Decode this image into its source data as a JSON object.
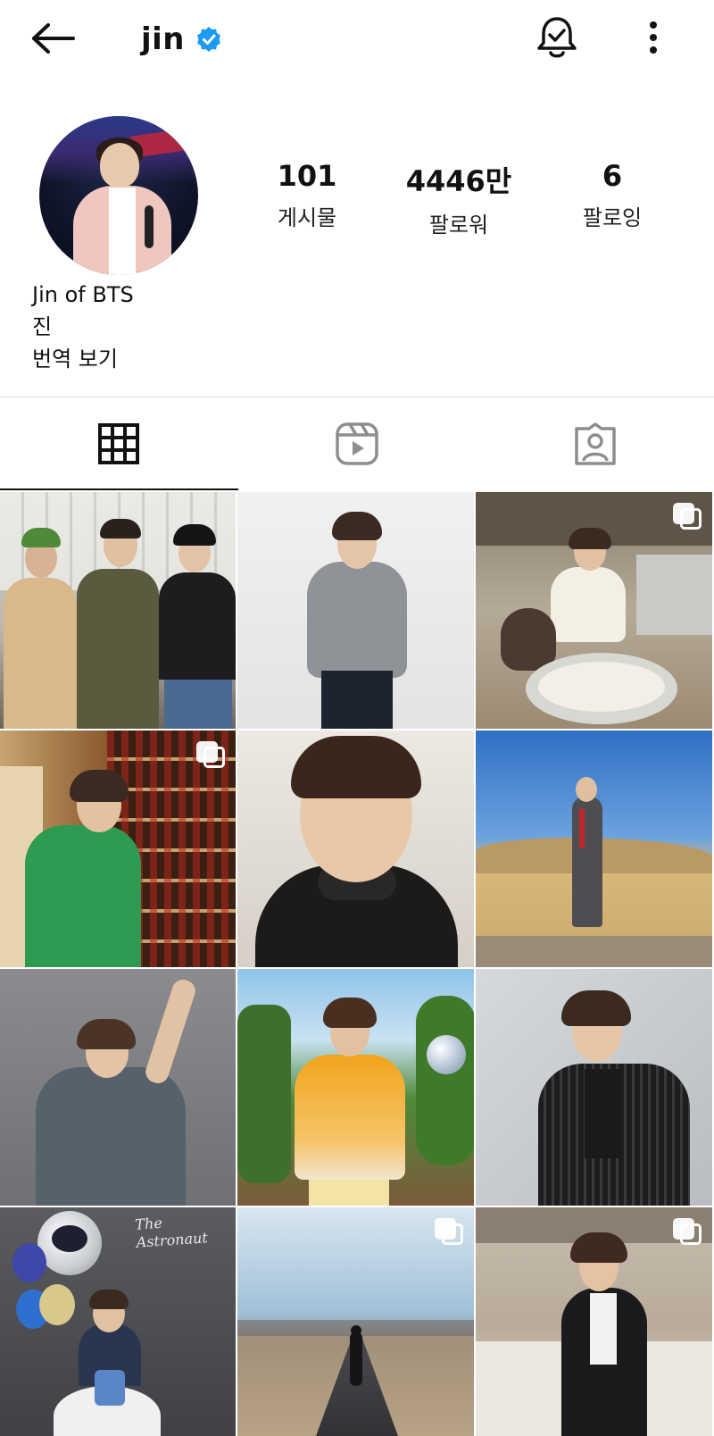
{
  "header": {
    "username": "jin",
    "verified": true,
    "accent_color": "#1d9bf0",
    "back_icon": "arrow-left-icon",
    "notification_icon": "bell-check-icon",
    "more_icon": "more-vertical-icon"
  },
  "profile": {
    "stats": {
      "posts_value": "101",
      "posts_label": "게시물",
      "followers_value": "4446만",
      "followers_label": "팔로워",
      "following_value": "6",
      "following_label": "팔로잉"
    },
    "bio": {
      "name_line": "Jin of BTS",
      "korean_line": "진",
      "translate_label": "번역 보기"
    }
  },
  "tabs": [
    {
      "icon": "grid-icon",
      "active": true
    },
    {
      "icon": "reels-icon",
      "active": false
    },
    {
      "icon": "tagged-icon",
      "active": false
    }
  ],
  "grid": {
    "posts": [
      {
        "index": 1,
        "multi": false
      },
      {
        "index": 2,
        "multi": false
      },
      {
        "index": 3,
        "multi": true
      },
      {
        "index": 4,
        "multi": true
      },
      {
        "index": 5,
        "multi": false
      },
      {
        "index": 6,
        "multi": false
      },
      {
        "index": 7,
        "multi": false
      },
      {
        "index": 8,
        "multi": false
      },
      {
        "index": 9,
        "multi": false
      },
      {
        "index": 10,
        "multi": false,
        "caption_text": "The Astronaut"
      },
      {
        "index": 11,
        "multi": true
      },
      {
        "index": 12,
        "multi": true
      }
    ]
  }
}
